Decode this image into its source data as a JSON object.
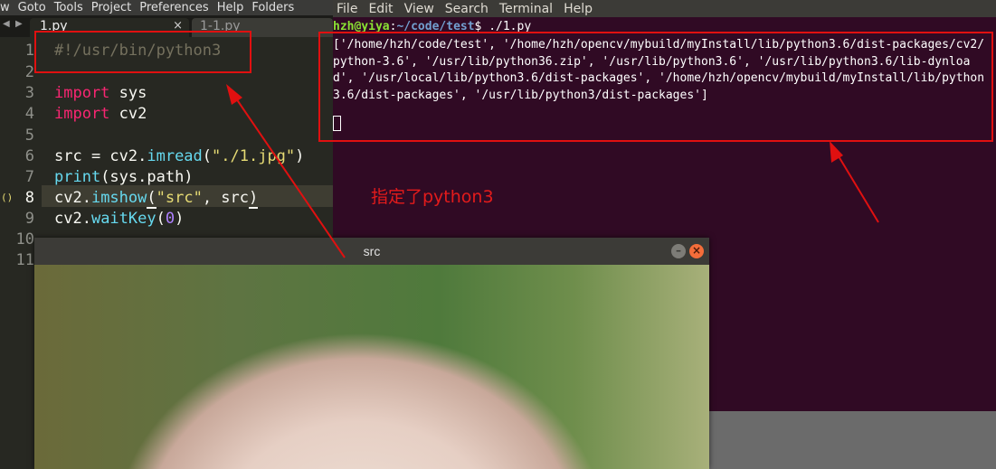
{
  "editor": {
    "menu": [
      "w",
      "Goto",
      "Tools",
      "Project",
      "Preferences",
      "Help",
      "Folders"
    ],
    "tabs": [
      {
        "label": "1.py",
        "close": "×"
      },
      {
        "label": "1-1.py"
      }
    ],
    "line_numbers": [
      "1",
      "2",
      "3",
      "4",
      "5",
      "6",
      "7",
      "8",
      "9",
      "10",
      "11"
    ],
    "gutter_mark": "()",
    "code": {
      "l1": "#!/usr/bin/python3",
      "l3_kw": "import",
      "l3_mod": " sys",
      "l4_kw": "import",
      "l4_mod": " cv2",
      "l6_a": "src = cv2.",
      "l6_fn": "imread",
      "l6_b": "(",
      "l6_str": "\"./1.jpg\"",
      "l6_c": ")",
      "l7_fn": "print",
      "l7_b": "(sys.path)",
      "l8_a": "cv2.",
      "l8_fn": "imshow",
      "l8_b": "(",
      "l8_str": "\"src\"",
      "l8_c": ", src",
      "l8_d": ")",
      "l9_a": "cv2.",
      "l9_fn": "waitKey",
      "l9_b": "(",
      "l9_num": "0",
      "l9_c": ")"
    }
  },
  "terminal": {
    "menu": [
      "File",
      "Edit",
      "View",
      "Search",
      "Terminal",
      "Help"
    ],
    "prompt_user": "hzh@yiya",
    "prompt_sep": ":",
    "prompt_path": "~/code/test",
    "prompt_cmd": "$ ./1.py",
    "output": "['/home/hzh/code/test', '/home/hzh/opencv/mybuild/myInstall/lib/python3.6/dist-packages/cv2/python-3.6', '/usr/lib/python36.zip', '/usr/lib/python3.6', '/usr/lib/python3.6/lib-dynload', '/usr/local/lib/python3.6/dist-packages', '/home/hzh/opencv/mybuild/myInstall/lib/python3.6/dist-packages', '/usr/lib/python3/dist-packages']"
  },
  "image_window": {
    "title": "src",
    "minimize": "–",
    "close": "×"
  },
  "annotation": {
    "note": "指定了python3",
    "color": "#e01010"
  }
}
